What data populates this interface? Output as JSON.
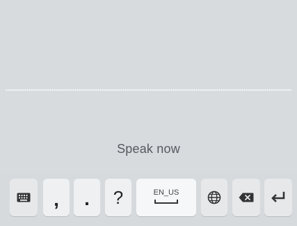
{
  "voice_input": {
    "prompt": "Speak now"
  },
  "keyboard_row": {
    "comma": ",",
    "period": ".",
    "question": "?",
    "space_language": "EN_US"
  },
  "icons": {
    "keyboard": "keyboard-icon",
    "space": "space-bar-icon",
    "globe": "globe-icon",
    "backspace": "backspace-icon",
    "enter": "enter-icon"
  },
  "colors": {
    "background": "#d8dbde",
    "key": "#eef0f2",
    "text": "#555a5f"
  }
}
